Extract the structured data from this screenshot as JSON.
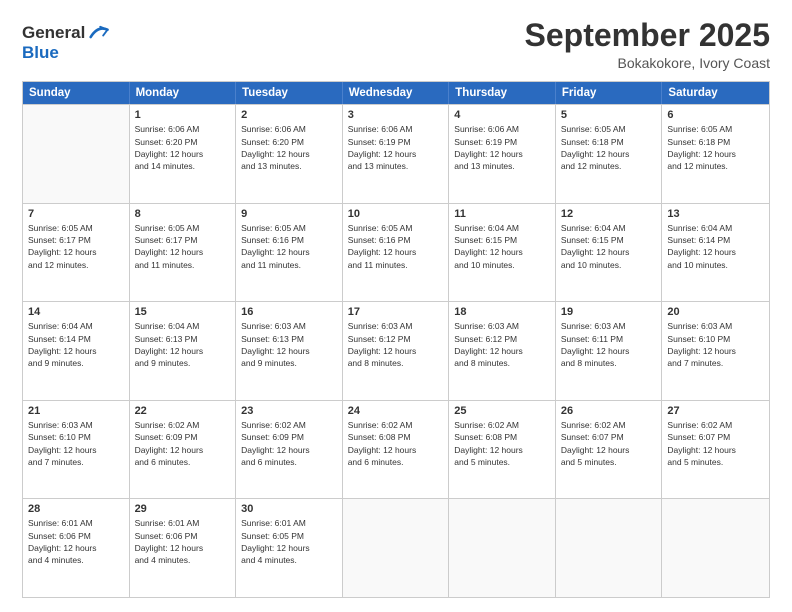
{
  "header": {
    "logo_line1": "General",
    "logo_line2": "Blue",
    "month": "September 2025",
    "location": "Bokakokore, Ivory Coast"
  },
  "days_of_week": [
    "Sunday",
    "Monday",
    "Tuesday",
    "Wednesday",
    "Thursday",
    "Friday",
    "Saturday"
  ],
  "weeks": [
    [
      {
        "day": "",
        "info": ""
      },
      {
        "day": "1",
        "info": "Sunrise: 6:06 AM\nSunset: 6:20 PM\nDaylight: 12 hours\nand 14 minutes."
      },
      {
        "day": "2",
        "info": "Sunrise: 6:06 AM\nSunset: 6:20 PM\nDaylight: 12 hours\nand 13 minutes."
      },
      {
        "day": "3",
        "info": "Sunrise: 6:06 AM\nSunset: 6:19 PM\nDaylight: 12 hours\nand 13 minutes."
      },
      {
        "day": "4",
        "info": "Sunrise: 6:06 AM\nSunset: 6:19 PM\nDaylight: 12 hours\nand 13 minutes."
      },
      {
        "day": "5",
        "info": "Sunrise: 6:05 AM\nSunset: 6:18 PM\nDaylight: 12 hours\nand 12 minutes."
      },
      {
        "day": "6",
        "info": "Sunrise: 6:05 AM\nSunset: 6:18 PM\nDaylight: 12 hours\nand 12 minutes."
      }
    ],
    [
      {
        "day": "7",
        "info": "Sunrise: 6:05 AM\nSunset: 6:17 PM\nDaylight: 12 hours\nand 12 minutes."
      },
      {
        "day": "8",
        "info": "Sunrise: 6:05 AM\nSunset: 6:17 PM\nDaylight: 12 hours\nand 11 minutes."
      },
      {
        "day": "9",
        "info": "Sunrise: 6:05 AM\nSunset: 6:16 PM\nDaylight: 12 hours\nand 11 minutes."
      },
      {
        "day": "10",
        "info": "Sunrise: 6:05 AM\nSunset: 6:16 PM\nDaylight: 12 hours\nand 11 minutes."
      },
      {
        "day": "11",
        "info": "Sunrise: 6:04 AM\nSunset: 6:15 PM\nDaylight: 12 hours\nand 10 minutes."
      },
      {
        "day": "12",
        "info": "Sunrise: 6:04 AM\nSunset: 6:15 PM\nDaylight: 12 hours\nand 10 minutes."
      },
      {
        "day": "13",
        "info": "Sunrise: 6:04 AM\nSunset: 6:14 PM\nDaylight: 12 hours\nand 10 minutes."
      }
    ],
    [
      {
        "day": "14",
        "info": "Sunrise: 6:04 AM\nSunset: 6:14 PM\nDaylight: 12 hours\nand 9 minutes."
      },
      {
        "day": "15",
        "info": "Sunrise: 6:04 AM\nSunset: 6:13 PM\nDaylight: 12 hours\nand 9 minutes."
      },
      {
        "day": "16",
        "info": "Sunrise: 6:03 AM\nSunset: 6:13 PM\nDaylight: 12 hours\nand 9 minutes."
      },
      {
        "day": "17",
        "info": "Sunrise: 6:03 AM\nSunset: 6:12 PM\nDaylight: 12 hours\nand 8 minutes."
      },
      {
        "day": "18",
        "info": "Sunrise: 6:03 AM\nSunset: 6:12 PM\nDaylight: 12 hours\nand 8 minutes."
      },
      {
        "day": "19",
        "info": "Sunrise: 6:03 AM\nSunset: 6:11 PM\nDaylight: 12 hours\nand 8 minutes."
      },
      {
        "day": "20",
        "info": "Sunrise: 6:03 AM\nSunset: 6:10 PM\nDaylight: 12 hours\nand 7 minutes."
      }
    ],
    [
      {
        "day": "21",
        "info": "Sunrise: 6:03 AM\nSunset: 6:10 PM\nDaylight: 12 hours\nand 7 minutes."
      },
      {
        "day": "22",
        "info": "Sunrise: 6:02 AM\nSunset: 6:09 PM\nDaylight: 12 hours\nand 6 minutes."
      },
      {
        "day": "23",
        "info": "Sunrise: 6:02 AM\nSunset: 6:09 PM\nDaylight: 12 hours\nand 6 minutes."
      },
      {
        "day": "24",
        "info": "Sunrise: 6:02 AM\nSunset: 6:08 PM\nDaylight: 12 hours\nand 6 minutes."
      },
      {
        "day": "25",
        "info": "Sunrise: 6:02 AM\nSunset: 6:08 PM\nDaylight: 12 hours\nand 5 minutes."
      },
      {
        "day": "26",
        "info": "Sunrise: 6:02 AM\nSunset: 6:07 PM\nDaylight: 12 hours\nand 5 minutes."
      },
      {
        "day": "27",
        "info": "Sunrise: 6:02 AM\nSunset: 6:07 PM\nDaylight: 12 hours\nand 5 minutes."
      }
    ],
    [
      {
        "day": "28",
        "info": "Sunrise: 6:01 AM\nSunset: 6:06 PM\nDaylight: 12 hours\nand 4 minutes."
      },
      {
        "day": "29",
        "info": "Sunrise: 6:01 AM\nSunset: 6:06 PM\nDaylight: 12 hours\nand 4 minutes."
      },
      {
        "day": "30",
        "info": "Sunrise: 6:01 AM\nSunset: 6:05 PM\nDaylight: 12 hours\nand 4 minutes."
      },
      {
        "day": "",
        "info": ""
      },
      {
        "day": "",
        "info": ""
      },
      {
        "day": "",
        "info": ""
      },
      {
        "day": "",
        "info": ""
      }
    ]
  ]
}
